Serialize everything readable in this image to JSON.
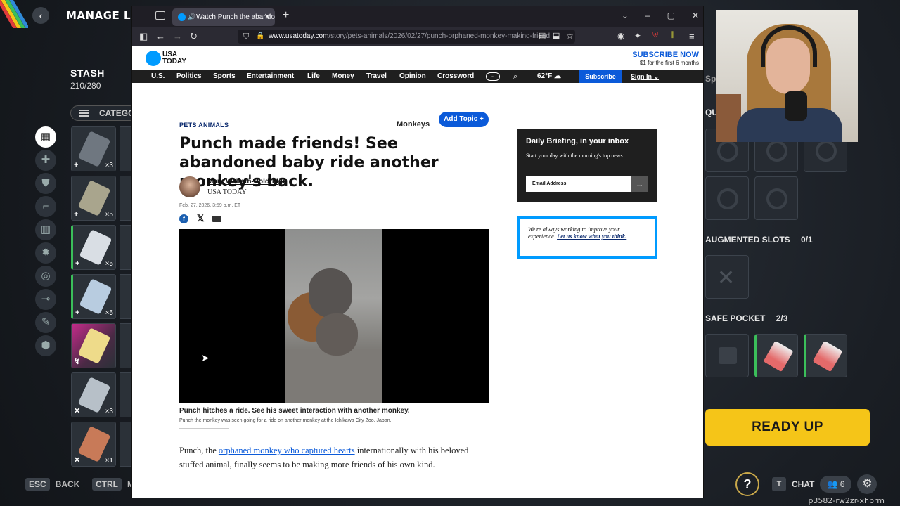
{
  "game": {
    "title": "MANAGE LOAD",
    "stash": {
      "title": "STASH",
      "count": "210/280",
      "category_label": "CATEGO"
    },
    "side_icons": [
      "grid-icon",
      "bandage-icon",
      "shield-icon",
      "gun-icon",
      "books-icon",
      "explosive-icon",
      "ring-icon",
      "scope-icon",
      "wrench-icon",
      "cube-icon"
    ],
    "stash_slots": [
      {
        "qty": "×3",
        "badge": "+",
        "color": "#6f7780"
      },
      {
        "qty": "×5",
        "badge": "+",
        "color": "#a9a58d"
      },
      {
        "qty": "×5",
        "badge": "+",
        "color": "#d9dee4"
      },
      {
        "qty": "×5",
        "badge": "+",
        "color": "#b8cce0"
      },
      {
        "qty": "",
        "badge": "↯",
        "color": "#eedb8a"
      },
      {
        "qty": "×3",
        "badge": "✕",
        "color": "#b7c0c8"
      },
      {
        "qty": "×1",
        "badge": "✕",
        "color": "#c87a58"
      }
    ],
    "augmented_slots": {
      "label": "AUGMENTED SLOTS",
      "count": "0/1"
    },
    "safe_pocket": {
      "label": "SAFE POCKET",
      "count": "2/3"
    },
    "quick_label": "QU",
    "spec_label": "Spe",
    "ready_button": "READY UP",
    "key_hints": {
      "esc_key": "ESC",
      "esc_label": "BACK",
      "ctrl_key": "CTRL",
      "ctrl_label": "M"
    },
    "chat": {
      "key": "T",
      "label": "CHAT"
    },
    "party_count": "6",
    "session_id": "p3582-rw2zr-xhprm",
    "colors": {
      "ready": "#f5c518",
      "rarity_green": "#3bbf5a"
    }
  },
  "browser": {
    "tab_title": "Watch Punch the abandone",
    "url_domain": "www.usatoday.com",
    "url_path": "/story/pets-animals/2026/02/27/punch-orphaned-monkey-making-friend"
  },
  "site": {
    "logo_line1": "USA",
    "logo_line2": "TODAY",
    "subscribe_now": "SUBSCRIBE NOW",
    "subscribe_sub": "$1 for the first 6 months",
    "nav": [
      "U.S.",
      "Politics",
      "Sports",
      "Entertainment",
      "Life",
      "Money",
      "Travel",
      "Opinion",
      "Crossword"
    ],
    "weather": "62°F",
    "subscribe_btn": "Subscribe",
    "sign_in": "Sign In",
    "colors": {
      "brand": "#009bff",
      "link": "#0b5ad9"
    }
  },
  "article": {
    "topic": "PETS ANIMALS",
    "topic_link": "Monkeys",
    "add_topic": "Add Topic +",
    "headline": "Punch made friends! See abandoned baby ride another monkey's back.",
    "author": "Mary Walrath-Holdridge",
    "publication": "USA TODAY",
    "date": "Feb. 27, 2026, 3:59 p.m. ET",
    "caption_title": "Punch hitches a ride. See his sweet interaction with another monkey.",
    "caption_sub": "Punch the monkey was seen going for a ride on another monkey at the Ichikawa City Zoo, Japan.",
    "body_pre": "Punch, the ",
    "body_link": "orphaned monkey who captured hearts",
    "body_post": " internationally with his beloved stuffed animal, finally seems to be making more friends of his own kind."
  },
  "sidebar": {
    "newsletter_title": "Daily Briefing, in your inbox",
    "newsletter_desc": "Start your day with the morning's top news.",
    "email_placeholder": "Email Address",
    "feedback_text": "We're always working to improve your experience. ",
    "feedback_link": "Let us know what you think."
  }
}
